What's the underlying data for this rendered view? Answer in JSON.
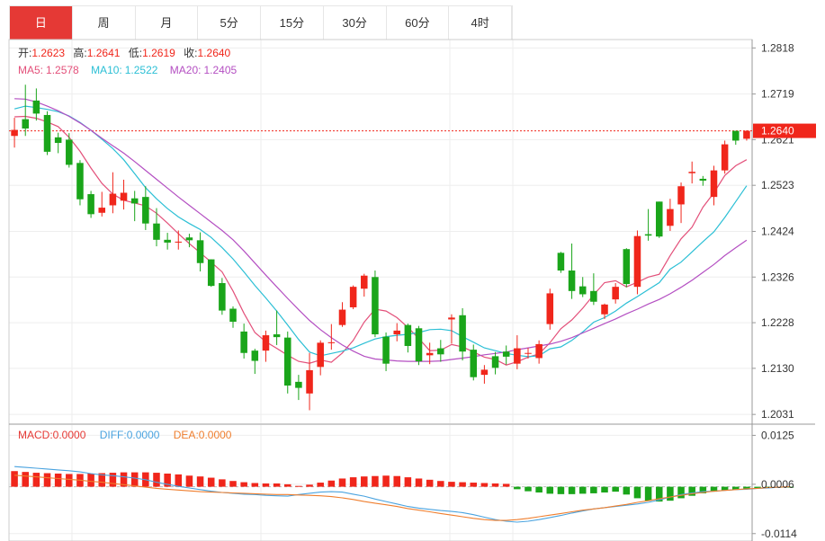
{
  "tabs": [
    {
      "label": "日",
      "active": true
    },
    {
      "label": "周"
    },
    {
      "label": "月"
    },
    {
      "label": "5分"
    },
    {
      "label": "15分"
    },
    {
      "label": "30分"
    },
    {
      "label": "60分"
    },
    {
      "label": "4时"
    }
  ],
  "ohlc_header": {
    "open_label": "开:",
    "open": "1.2623",
    "high_label": "高:",
    "high": "1.2641",
    "low_label": "低:",
    "low": "1.2619",
    "close_label": "收:",
    "close": "1.2640"
  },
  "ma_header": {
    "ma5_label": "MA5:",
    "ma5": "1.2578",
    "ma10_label": "MA10:",
    "ma10": "1.2522",
    "ma20_label": "MA20:",
    "ma20": "1.2405"
  },
  "macd_header": {
    "macd_label": "MACD:",
    "macd": "0.0000",
    "diff_label": "DIFF:",
    "diff": "0.0000",
    "dea_label": "DEA:",
    "dea": "0.0000"
  },
  "colors": {
    "up": "#f0261b",
    "down": "#1aa51a",
    "ma5": "#e3507a",
    "ma10": "#2bbfd5",
    "ma20": "#b44fc2",
    "diff": "#4aa3df",
    "dea": "#ef7e2e",
    "tab_active": "#e53935",
    "price_tag": "#f0261b"
  },
  "chart_data": [
    {
      "type": "candlestick",
      "y_ticks": [
        "1.2818",
        "1.2719",
        "1.2621",
        "1.2523",
        "1.2424",
        "1.2326",
        "1.2228",
        "1.2130",
        "1.2031"
      ],
      "ylim": [
        1.2012,
        1.2836
      ],
      "current_price": "1.2640",
      "candles": [
        [
          1.2629,
          1.2642,
          1.2604,
          1.2668
        ],
        [
          1.2665,
          1.2645,
          1.2629,
          1.2739
        ],
        [
          1.2705,
          1.2677,
          1.2662,
          1.2731
        ],
        [
          1.2674,
          1.2595,
          1.2588,
          1.2682
        ],
        [
          1.2626,
          1.2614,
          1.2592,
          1.2636
        ],
        [
          1.2621,
          1.2567,
          1.2561,
          1.2635
        ],
        [
          1.2571,
          1.2493,
          1.248,
          1.2577
        ],
        [
          1.2504,
          1.2461,
          1.2453,
          1.2511
        ],
        [
          1.2464,
          1.2475,
          1.2456,
          1.2509
        ],
        [
          1.248,
          1.2505,
          1.2463,
          1.2551
        ],
        [
          1.249,
          1.2507,
          1.2471,
          1.2535
        ],
        [
          1.2495,
          1.2484,
          1.2446,
          1.2511
        ],
        [
          1.2498,
          1.2441,
          1.2427,
          1.2521
        ],
        [
          1.2441,
          1.2406,
          1.2392,
          1.2474
        ],
        [
          1.2406,
          1.24,
          1.2385,
          1.2421
        ],
        [
          1.24,
          1.2402,
          1.2385,
          1.2426
        ],
        [
          1.2411,
          1.2405,
          1.239,
          1.2419
        ],
        [
          1.2405,
          1.2356,
          1.2338,
          1.2422
        ],
        [
          1.2364,
          1.2307,
          1.2305,
          1.2364
        ],
        [
          1.2313,
          1.2254,
          1.2245,
          1.2324
        ],
        [
          1.2258,
          1.223,
          1.2217,
          1.2263
        ],
        [
          1.2209,
          1.2163,
          1.2151,
          1.2226
        ],
        [
          1.2168,
          1.2146,
          1.2118,
          1.2172
        ],
        [
          1.2168,
          1.2201,
          1.2144,
          1.2211
        ],
        [
          1.2203,
          1.2197,
          1.218,
          1.2254
        ],
        [
          1.2196,
          1.2093,
          1.2076,
          1.2209
        ],
        [
          1.2101,
          1.2088,
          1.2062,
          1.2116
        ],
        [
          1.2076,
          1.2126,
          1.204,
          1.2163
        ],
        [
          1.2133,
          1.2185,
          1.2115,
          1.219
        ],
        [
          1.2184,
          1.2186,
          1.217,
          1.2225
        ],
        [
          1.2223,
          1.2256,
          1.2219,
          1.2272
        ],
        [
          1.2261,
          1.2305,
          1.2257,
          1.2308
        ],
        [
          1.2301,
          1.2329,
          1.2284,
          1.2333
        ],
        [
          1.2326,
          1.2203,
          1.2197,
          1.234
        ],
        [
          1.2198,
          1.214,
          1.2124,
          1.2207
        ],
        [
          1.2203,
          1.2211,
          1.2188,
          1.2227
        ],
        [
          1.2223,
          1.2178,
          1.2164,
          1.2226
        ],
        [
          1.2216,
          1.2145,
          1.2137,
          1.2221
        ],
        [
          1.2158,
          1.2163,
          1.2139,
          1.2185
        ],
        [
          1.2173,
          1.216,
          1.2144,
          1.2191
        ],
        [
          1.2235,
          1.2239,
          1.2183,
          1.2246
        ],
        [
          1.2244,
          1.2166,
          1.2147,
          1.2259
        ],
        [
          1.217,
          1.2111,
          1.2104,
          1.2181
        ],
        [
          1.2116,
          1.2127,
          1.2097,
          1.2137
        ],
        [
          1.2156,
          1.2131,
          1.2117,
          1.2165
        ],
        [
          1.2166,
          1.2155,
          1.2138,
          1.2179
        ],
        [
          1.214,
          1.2173,
          1.2128,
          1.2201
        ],
        [
          1.2163,
          1.2163,
          1.2151,
          1.2174
        ],
        [
          1.2152,
          1.2182,
          1.214,
          1.219
        ],
        [
          1.2225,
          1.2291,
          1.2213,
          1.2301
        ],
        [
          1.2378,
          1.234,
          1.2335,
          1.238
        ],
        [
          1.234,
          1.2296,
          1.2279,
          1.2398
        ],
        [
          1.2306,
          1.2289,
          1.2283,
          1.2326
        ],
        [
          1.2296,
          1.2273,
          1.2266,
          1.2334
        ],
        [
          1.2246,
          1.2267,
          1.2236,
          1.2269
        ],
        [
          1.2278,
          1.2305,
          1.2269,
          1.2313
        ],
        [
          1.2386,
          1.2311,
          1.2304,
          1.2388
        ],
        [
          1.2305,
          1.2414,
          1.2289,
          1.2426
        ],
        [
          1.2418,
          1.2415,
          1.2404,
          1.2472
        ],
        [
          1.2488,
          1.2413,
          1.241,
          1.2488
        ],
        [
          1.2436,
          1.2472,
          1.2425,
          1.2494
        ],
        [
          1.2482,
          1.2521,
          1.2442,
          1.2529
        ],
        [
          1.2549,
          1.2552,
          1.2527,
          1.2574
        ],
        [
          1.2537,
          1.2533,
          1.2522,
          1.2543
        ],
        [
          1.2498,
          1.2555,
          1.248,
          1.2565
        ],
        [
          1.2555,
          1.2611,
          1.2548,
          1.2619
        ],
        [
          1.264,
          1.2619,
          1.261,
          1.2623
        ],
        [
          1.2623,
          1.264,
          1.2619,
          1.2641
        ]
      ],
      "series": [
        {
          "name": "MA5",
          "color": "#e3507a",
          "values": [
            1.267,
            1.2671,
            1.2667,
            1.2659,
            1.2649,
            1.2626,
            1.2596,
            1.256,
            1.2527,
            1.2504,
            1.2491,
            1.2485,
            1.2479,
            1.2463,
            1.2442,
            1.2419,
            1.2398,
            1.2378,
            1.2358,
            1.2337,
            1.2296,
            1.2248,
            1.2207,
            1.2187,
            1.2173,
            1.2158,
            1.2145,
            1.2141,
            1.2148,
            1.2143,
            1.2163,
            1.219,
            1.2229,
            1.2257,
            1.2253,
            1.2239,
            1.2218,
            1.2194,
            1.2168,
            1.2169,
            1.2181,
            1.2176,
            1.2165,
            1.2154,
            1.2149,
            1.2137,
            1.2144,
            1.2154,
            1.2161,
            1.2185,
            1.2215,
            1.2234,
            1.2259,
            1.2288,
            1.2314,
            1.2318,
            1.2305,
            1.2315,
            1.2326,
            1.2332,
            1.2372,
            1.2408,
            1.2433,
            1.2476,
            1.2507,
            1.2544,
            1.2565,
            1.2578
          ]
        },
        {
          "name": "MA10",
          "color": "#2bbfd5",
          "values": [
            1.2687,
            1.2693,
            1.269,
            1.2686,
            1.2681,
            1.2672,
            1.2658,
            1.2641,
            1.2622,
            1.2602,
            1.2578,
            1.2548,
            1.2518,
            1.2494,
            1.2473,
            1.2455,
            1.2441,
            1.2428,
            1.2411,
            1.2389,
            1.2365,
            1.2337,
            1.2308,
            1.2281,
            1.2253,
            1.2223,
            1.2192,
            1.2165,
            1.2157,
            1.2162,
            1.2167,
            1.2174,
            1.2184,
            1.2193,
            1.2198,
            1.2201,
            1.2203,
            1.2207,
            1.2213,
            1.2214,
            1.2211,
            1.2198,
            1.2186,
            1.2174,
            1.2168,
            1.2162,
            1.2158,
            1.2155,
            1.2157,
            1.2172,
            1.2176,
            1.219,
            1.2208,
            1.2229,
            1.2239,
            1.2253,
            1.227,
            1.2284,
            1.2299,
            1.2314,
            1.2343,
            1.2358,
            1.238,
            1.2402,
            1.2423,
            1.2454,
            1.2488,
            1.2522
          ]
        },
        {
          "name": "MA20",
          "color": "#b44fc2",
          "values": [
            1.2709,
            1.2708,
            1.2702,
            1.2693,
            1.2683,
            1.2671,
            1.2657,
            1.2641,
            1.2624,
            1.2608,
            1.2592,
            1.2574,
            1.2555,
            1.2536,
            1.2517,
            1.2498,
            1.248,
            1.2462,
            1.2444,
            1.2426,
            1.2406,
            1.2382,
            1.2356,
            1.233,
            1.2305,
            1.228,
            1.2256,
            1.2233,
            1.2213,
            1.2196,
            1.218,
            1.2167,
            1.2156,
            1.215,
            1.2148,
            1.2146,
            1.2145,
            1.2145,
            1.2145,
            1.2146,
            1.2149,
            1.2152,
            1.2155,
            1.2159,
            1.2162,
            1.2165,
            1.217,
            1.2174,
            1.2178,
            1.2182,
            1.2188,
            1.2196,
            1.2206,
            1.2216,
            1.2226,
            1.2236,
            1.2247,
            1.2257,
            1.2268,
            1.2278,
            1.229,
            1.2304,
            1.2319,
            1.2336,
            1.2353,
            1.2372,
            1.2389,
            1.2405
          ]
        }
      ]
    },
    {
      "type": "bar",
      "y_ticks": [
        "0.0125",
        "0.0006",
        "-0.0114"
      ],
      "ylim": [
        -0.0132,
        0.015
      ],
      "values": [
        0.0038,
        0.0036,
        0.0034,
        0.0033,
        0.0032,
        0.0031,
        0.0031,
        0.0032,
        0.0033,
        0.0034,
        0.0035,
        0.0035,
        0.0035,
        0.0034,
        0.0032,
        0.003,
        0.0027,
        0.0025,
        0.0022,
        0.0018,
        0.0014,
        0.0011,
        0.0009,
        0.0008,
        0.0008,
        0.0006,
        0.0002,
        0.0005,
        0.001,
        0.0015,
        0.002,
        0.0023,
        0.0025,
        0.0026,
        0.0027,
        0.0026,
        0.0023,
        0.002,
        0.0017,
        0.0014,
        0.0012,
        0.0011,
        0.001,
        0.0009,
        0.0008,
        0.0007,
        -0.0006,
        -0.0011,
        -0.0014,
        -0.0017,
        -0.0018,
        -0.0018,
        -0.0017,
        -0.0016,
        -0.0014,
        -0.0012,
        -0.0019,
        -0.0028,
        -0.0034,
        -0.0036,
        -0.0034,
        -0.0028,
        -0.0022,
        -0.0016,
        -0.0012,
        -0.0009,
        -0.0007,
        -0.0005,
        -0.0003,
        -0.0002,
        -0.0001,
        -0.0001
      ],
      "series": [
        {
          "name": "DIFF",
          "color": "#4aa3df",
          "values": [
            0.0049,
            0.0047,
            0.0045,
            0.0043,
            0.0041,
            0.0039,
            0.0036,
            0.0032,
            0.0029,
            0.0027,
            0.0024,
            0.0021,
            0.0017,
            0.0011,
            0.0006,
            0.0001,
            -0.0003,
            -0.0007,
            -0.0011,
            -0.0014,
            -0.0016,
            -0.0018,
            -0.0019,
            -0.0021,
            -0.0022,
            -0.0023,
            -0.0019,
            -0.0016,
            -0.0013,
            -0.0012,
            -0.0013,
            -0.0018,
            -0.0023,
            -0.003,
            -0.0036,
            -0.0042,
            -0.0048,
            -0.0052,
            -0.0055,
            -0.0058,
            -0.006,
            -0.0063,
            -0.0068,
            -0.0074,
            -0.008,
            -0.0084,
            -0.0086,
            -0.0084,
            -0.008,
            -0.0075,
            -0.007,
            -0.0064,
            -0.0059,
            -0.0054,
            -0.0051,
            -0.0048,
            -0.0045,
            -0.0042,
            -0.0038,
            -0.0032,
            -0.0025,
            -0.0019,
            -0.0015,
            -0.0012,
            -0.0011,
            -0.0009,
            -0.0007,
            -0.0006,
            -0.0004,
            -0.0003,
            -0.0001,
            0.0
          ]
        },
        {
          "name": "DEA",
          "color": "#ef7e2e",
          "values": [
            0.0028,
            0.0026,
            0.0024,
            0.0022,
            0.002,
            0.0018,
            0.0016,
            0.0013,
            0.0011,
            0.0008,
            0.0005,
            0.0002,
            -0.0001,
            -0.0004,
            -0.0006,
            -0.0008,
            -0.001,
            -0.0012,
            -0.0013,
            -0.0014,
            -0.0015,
            -0.0016,
            -0.0017,
            -0.0018,
            -0.0019,
            -0.0019,
            -0.002,
            -0.0021,
            -0.0022,
            -0.0024,
            -0.0027,
            -0.0031,
            -0.0036,
            -0.004,
            -0.0044,
            -0.0048,
            -0.0053,
            -0.0057,
            -0.0061,
            -0.0065,
            -0.0069,
            -0.0073,
            -0.0077,
            -0.008,
            -0.0082,
            -0.0082,
            -0.008,
            -0.0077,
            -0.0073,
            -0.0069,
            -0.0065,
            -0.0061,
            -0.0057,
            -0.0054,
            -0.0051,
            -0.0047,
            -0.0043,
            -0.0038,
            -0.0034,
            -0.0029,
            -0.0025,
            -0.0021,
            -0.0017,
            -0.0014,
            -0.0011,
            -0.0009,
            -0.0007,
            -0.0005,
            -0.0004,
            -0.0002,
            -0.0001,
            0.0
          ]
        }
      ]
    }
  ]
}
